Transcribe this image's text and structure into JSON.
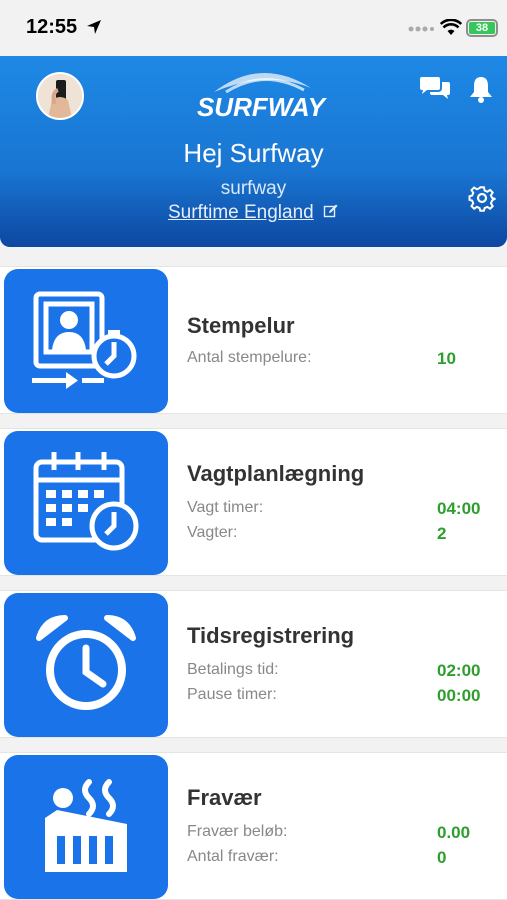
{
  "status_bar": {
    "time": "12:55",
    "battery": "38"
  },
  "header": {
    "logo_text": "SURFWAY",
    "greeting": "Hej Surfway",
    "username": "surfway",
    "company": "Surftime England"
  },
  "cards": [
    {
      "title": "Stempelur",
      "rows": [
        {
          "label": "Antal stempelure:",
          "value": "10"
        }
      ]
    },
    {
      "title": "Vagtplanlægning",
      "rows": [
        {
          "label": "Vagt timer:",
          "value": "04:00"
        },
        {
          "label": "Vagter:",
          "value": "2"
        }
      ]
    },
    {
      "title": "Tidsregistrering",
      "rows": [
        {
          "label": "Betalings tid:",
          "value": "02:00"
        },
        {
          "label": "Pause timer:",
          "value": "00:00"
        }
      ]
    },
    {
      "title": "Fravær",
      "rows": [
        {
          "label": "Fravær beløb:",
          "value": "0.00"
        },
        {
          "label": "Antal fravær:",
          "value": "0"
        }
      ]
    }
  ],
  "colors": {
    "header": "#1976d2",
    "icon_tile": "#1a73e8",
    "value_green": "#2e9e2e"
  },
  "icons": {
    "card_0": "time-clock-icon",
    "card_1": "calendar-clock-icon",
    "card_2": "alarm-clock-icon",
    "card_3": "absence-icon"
  }
}
